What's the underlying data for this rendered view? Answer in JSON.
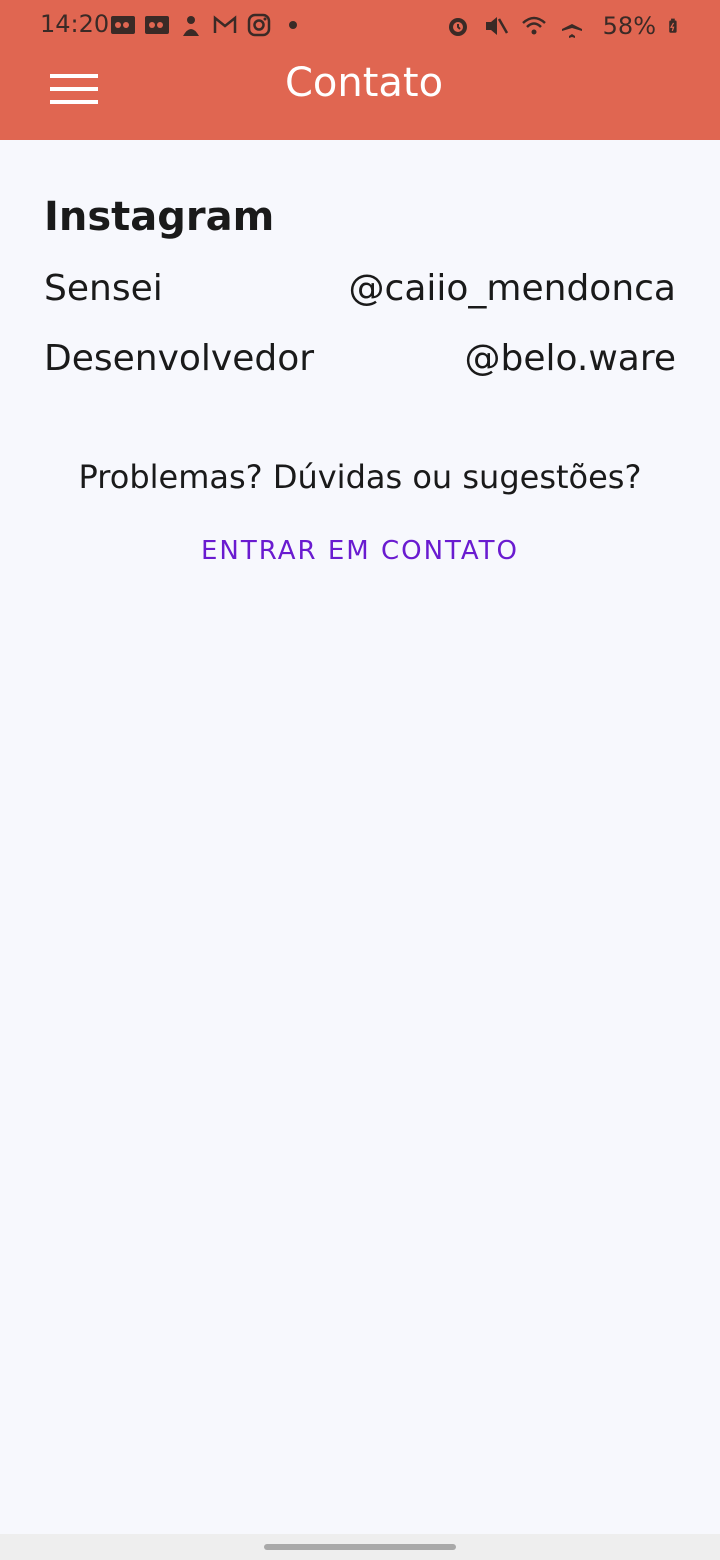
{
  "status_bar": {
    "time": "14:20",
    "battery": "58%",
    "left_icons": [
      "voicemail-icon",
      "voicemail-icon",
      "app-icon",
      "gmail-icon",
      "instagram-icon",
      "dot-icon"
    ],
    "right_icons": [
      "alarm-icon",
      "mute-icon",
      "wifi-icon",
      "airplane-icon",
      "battery-icon"
    ]
  },
  "app_bar": {
    "title": "Contato",
    "menu_icon": "hamburger-menu-icon",
    "background": "#e06651"
  },
  "content": {
    "section_title": "Instagram",
    "contacts": [
      {
        "label": "Sensei",
        "handle": "@caiio_mendonca"
      },
      {
        "label": "Desenvolvedor",
        "handle": "@belo.ware"
      }
    ],
    "prompt": "Problemas? Dúvidas ou sugestões?",
    "contact_button": "ENTRAR EM CONTATO",
    "accent": "#6a1bd0"
  }
}
